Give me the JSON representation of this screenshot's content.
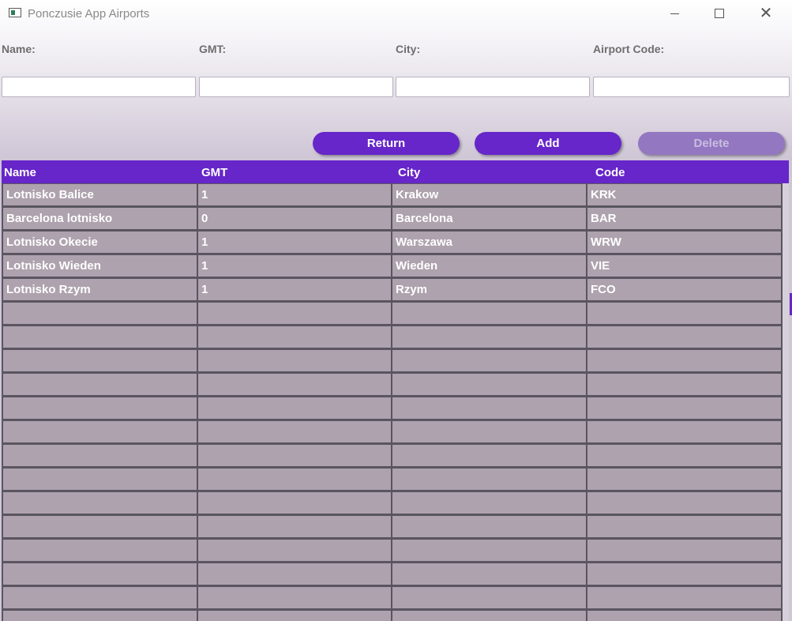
{
  "window": {
    "title": "Ponczusie App Airports"
  },
  "form": {
    "labels": [
      "Name:",
      "GMT:",
      "City:",
      "Airport Code:"
    ],
    "values": [
      "",
      "",
      "",
      ""
    ]
  },
  "buttons": {
    "return": "Return",
    "add": "Add",
    "delete": "Delete"
  },
  "table": {
    "columns": [
      "Name",
      "GMT",
      "City",
      "Code"
    ],
    "rows": [
      [
        "Lotnisko Balice",
        "1",
        "Krakow",
        "KRK"
      ],
      [
        "Barcelona lotnisko",
        "0",
        "Barcelona",
        "BAR"
      ],
      [
        "Lotnisko Okecie",
        "1",
        "Warszawa",
        "WRW"
      ],
      [
        "Lotnisko Wieden",
        "1",
        "Wieden",
        "VIE"
      ],
      [
        "Lotnisko Rzym",
        "1",
        "Rzym",
        "FCO"
      ]
    ],
    "empty_rows": 14
  },
  "colors": {
    "accent": "#6626c9",
    "disabled_button": "#9377c1",
    "cell_bg": "#ada2ad"
  },
  "icons": [
    "app-icon",
    "minimize-icon",
    "maximize-icon",
    "close-icon"
  ]
}
